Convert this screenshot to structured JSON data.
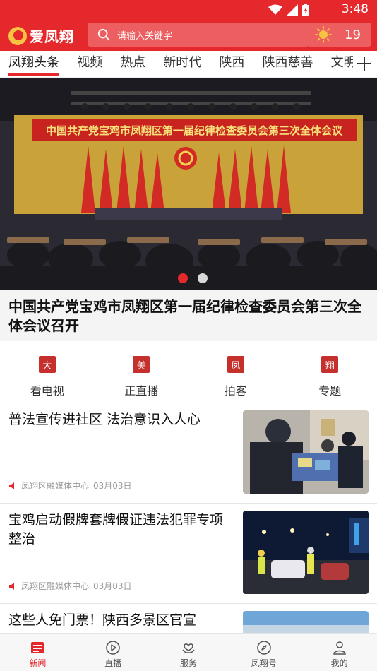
{
  "status_bar": {
    "time": "3:48"
  },
  "app": {
    "logo_text": "爱凤翔"
  },
  "search": {
    "placeholder": "请输入关键字"
  },
  "weather": {
    "temperature": "19",
    "icon": "sun-icon"
  },
  "tabs": [
    {
      "label": "凤翔头条",
      "active": true
    },
    {
      "label": "视频"
    },
    {
      "label": "热点"
    },
    {
      "label": "新时代"
    },
    {
      "label": "陕西"
    },
    {
      "label": "陕西慈善"
    },
    {
      "label": "文明"
    }
  ],
  "banner": {
    "banner_text": "中国共产党宝鸡市凤翔区第一届纪律检查委员会第三次全体会议",
    "headline": "中国共产党宝鸡市凤翔区第一届纪律检查委员会第三次全体会议召开",
    "slide_count": 2,
    "active_slide": 1
  },
  "quick_entries": [
    {
      "label": "看电视",
      "seal": "大"
    },
    {
      "label": "正直播",
      "seal": "美"
    },
    {
      "label": "拍客",
      "seal": "凤"
    },
    {
      "label": "专题",
      "seal": "翔"
    }
  ],
  "news": [
    {
      "title": "普法宣传进社区 法治意识入人心",
      "source": "凤翔区融媒体中心",
      "date": "03月03日"
    },
    {
      "title": "宝鸡启动假牌套牌假证违法犯罪专项整治",
      "source": "凤翔区融媒体中心",
      "date": "03月03日"
    },
    {
      "title": "这些人免门票！陕西多景区官宣",
      "source": "",
      "date": ""
    }
  ],
  "bottom_nav": [
    {
      "label": "新闻",
      "icon": "news-icon",
      "active": true
    },
    {
      "label": "直播",
      "icon": "play-icon"
    },
    {
      "label": "服务",
      "icon": "service-icon"
    },
    {
      "label": "凤翔号",
      "icon": "compass-icon"
    },
    {
      "label": "我的",
      "icon": "profile-icon"
    }
  ],
  "colors": {
    "brand": "#e4282b",
    "meta_text": "#999999"
  }
}
